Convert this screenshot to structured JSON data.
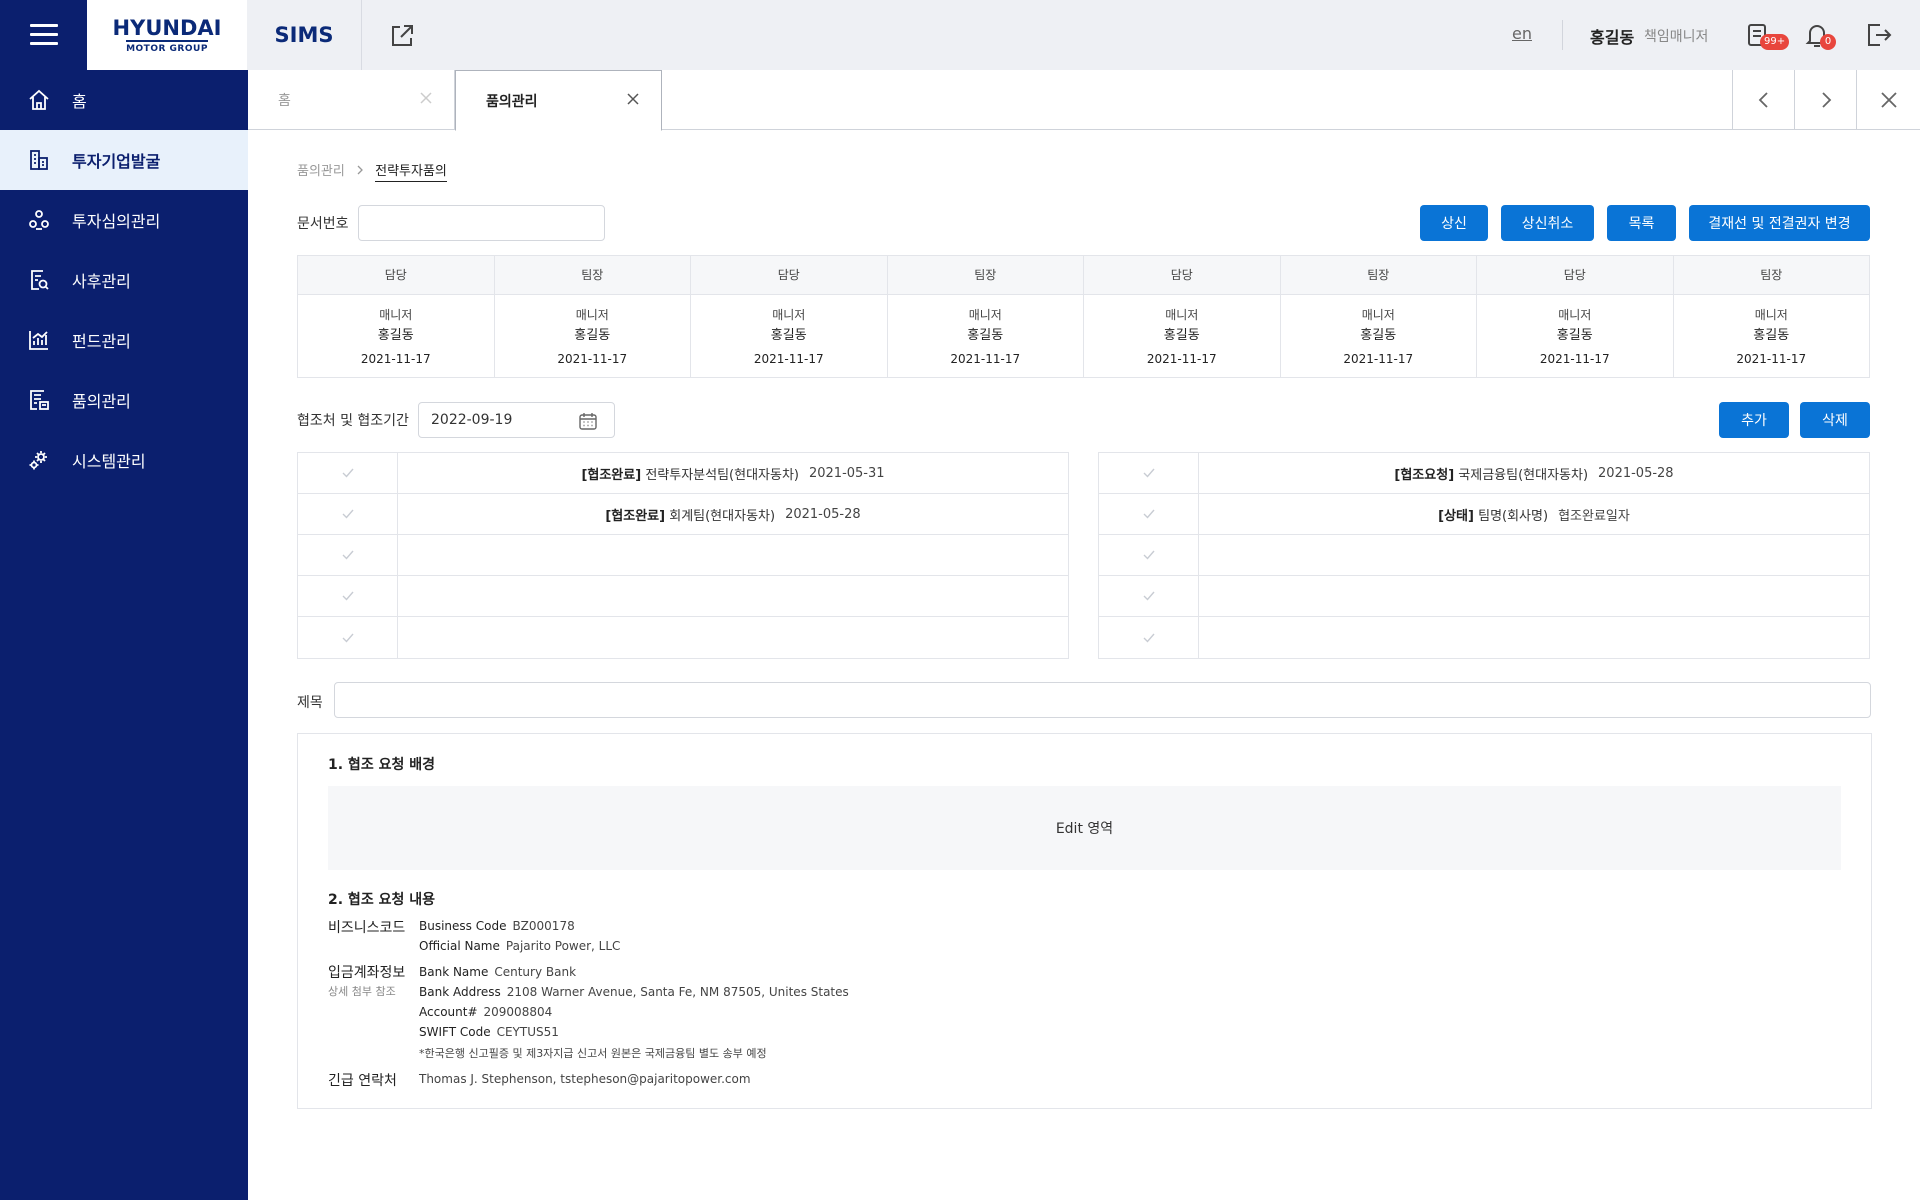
{
  "header": {
    "brand": "HYUNDAI",
    "brand_sub": "MOTOR GROUP",
    "app_name": "SIMS",
    "lang": "en",
    "user_name": "홍길동",
    "user_role": "책임매니저",
    "message_badge": "99+",
    "notification_badge": "0"
  },
  "sidebar": {
    "items": [
      {
        "label": "홈",
        "icon": "home-icon"
      },
      {
        "label": "투자기업발굴",
        "icon": "building-icon",
        "active": true
      },
      {
        "label": "투자심의관리",
        "icon": "people-network-icon"
      },
      {
        "label": "사후관리",
        "icon": "document-search-icon"
      },
      {
        "label": "펀드관리",
        "icon": "chart-icon"
      },
      {
        "label": "품의관리",
        "icon": "document-list-icon"
      },
      {
        "label": "시스템관리",
        "icon": "gear-icon"
      }
    ]
  },
  "tabs": [
    {
      "label": "홈",
      "active": false
    },
    {
      "label": "품의관리",
      "active": true
    }
  ],
  "breadcrumb": {
    "parent": "품의관리",
    "current": "전략투자품의"
  },
  "doc": {
    "doc_no_label": "문서번호",
    "doc_no_value": "",
    "buttons": [
      "상신",
      "상신취소",
      "목록",
      "결재선 및 전결권자 변경"
    ]
  },
  "approval": [
    {
      "role": "담당",
      "title": "매니저",
      "name": "홍길동",
      "date": "2021-11-17"
    },
    {
      "role": "팀장",
      "title": "매니저",
      "name": "홍길동",
      "date": "2021-11-17"
    },
    {
      "role": "담당",
      "title": "매니저",
      "name": "홍길동",
      "date": "2021-11-17"
    },
    {
      "role": "팀장",
      "title": "매니저",
      "name": "홍길동",
      "date": "2021-11-17"
    },
    {
      "role": "담당",
      "title": "매니저",
      "name": "홍길동",
      "date": "2021-11-17"
    },
    {
      "role": "팀장",
      "title": "매니저",
      "name": "홍길동",
      "date": "2021-11-17"
    },
    {
      "role": "담당",
      "title": "매니저",
      "name": "홍길동",
      "date": "2021-11-17"
    },
    {
      "role": "팀장",
      "title": "매니저",
      "name": "홍길동",
      "date": "2021-11-17"
    }
  ],
  "coop": {
    "label": "협조처 및 협조기간",
    "date": "2022-09-19",
    "add_label": "추가",
    "delete_label": "삭제",
    "left": [
      {
        "status": "[협조완료]",
        "text": "전략투자분석팀(현대자동차)",
        "date": "2021-05-31"
      },
      {
        "status": "[협조완료]",
        "text": "회계팀(현대자동차)",
        "date": "2021-05-28"
      },
      {
        "status": "",
        "text": "",
        "date": ""
      },
      {
        "status": "",
        "text": "",
        "date": ""
      },
      {
        "status": "",
        "text": "",
        "date": ""
      }
    ],
    "right": [
      {
        "status": "[협조요청]",
        "text": "국제금융팀(현대자동차)",
        "date": "2021-05-28"
      },
      {
        "status": "[상태]",
        "text": "팀명(회사명)",
        "date": "협조완료일자"
      },
      {
        "status": "",
        "text": "",
        "date": ""
      },
      {
        "status": "",
        "text": "",
        "date": ""
      },
      {
        "status": "",
        "text": "",
        "date": ""
      }
    ]
  },
  "subject": {
    "label": "제목",
    "value": ""
  },
  "content": {
    "section1_title": "1. 협조 요청 배경",
    "edit_area": "Edit 영역",
    "section2_title": "2. 협조 요청 내용",
    "business_label": "비즈니스코드",
    "business_code_key": "Business Code",
    "business_code_val": "BZ000178",
    "official_name_key": "Official Name",
    "official_name_val": "Pajarito Power, LLC",
    "account_label": "입금계좌정보",
    "account_sub": "상세 첨부 참조",
    "bank_name_key": "Bank Name",
    "bank_name_val": "Century Bank",
    "bank_addr_key": "Bank Address",
    "bank_addr_val": "2108 Warner Avenue, Santa Fe, NM 87505, Unites States",
    "account_no_key": "Account#",
    "account_no_val": "209008804",
    "swift_key": "SWIFT Code",
    "swift_val": "CEYTUS51",
    "note": "*한국은행 신고필증 및 제3자지급 신고서 원본은 국제금융팀 별도 송부 예정",
    "contact_label": "긴급 연락처",
    "contact_val": "Thomas J. Stephenson, tstepheson@pajaritopower.com"
  },
  "colors": {
    "sidebar_bg": "#0b1f6e",
    "accent_blue": "#0a74d6",
    "badge_red": "#e8463d"
  }
}
